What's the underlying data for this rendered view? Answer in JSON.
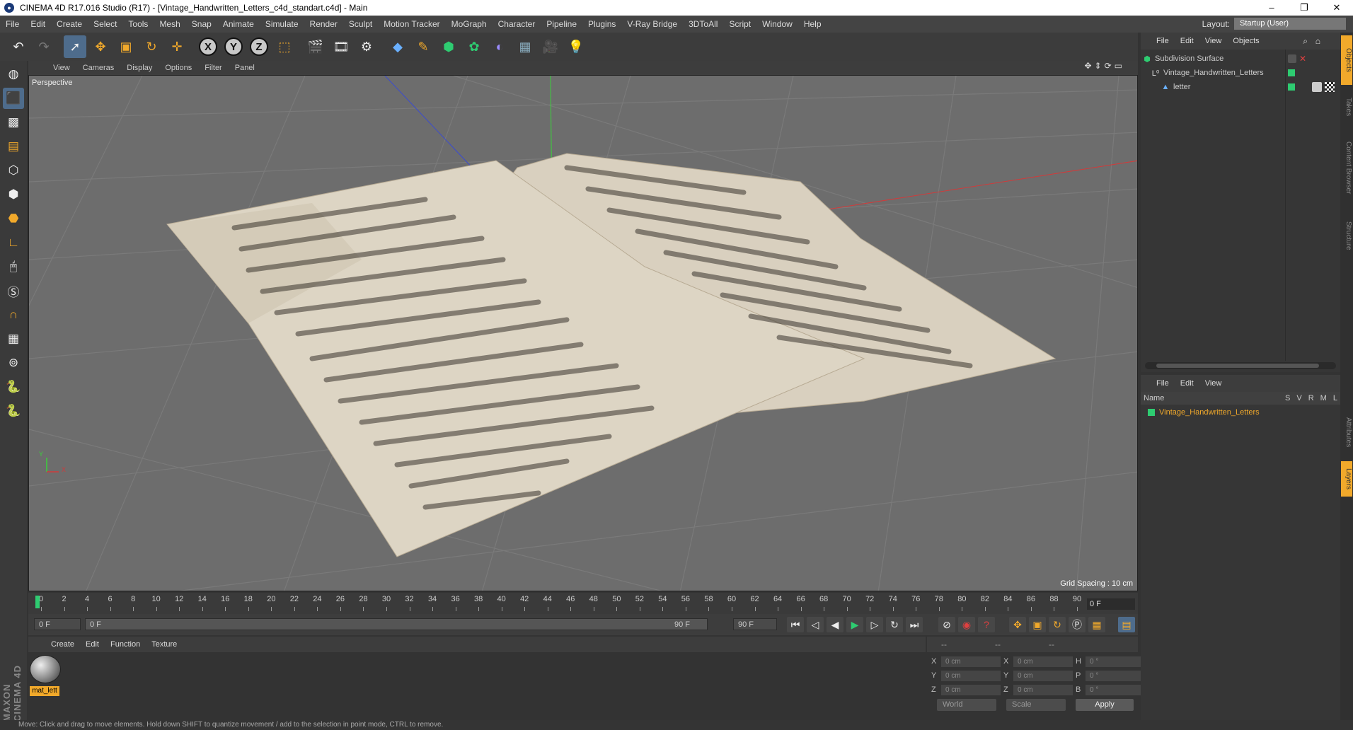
{
  "titlebar": {
    "title": "CINEMA 4D R17.016 Studio (R17) - [Vintage_Handwritten_Letters_c4d_standart.c4d] - Main",
    "min": "–",
    "restore": "❐",
    "close": "✕"
  },
  "menubar": {
    "items": [
      "File",
      "Edit",
      "Create",
      "Select",
      "Tools",
      "Mesh",
      "Snap",
      "Animate",
      "Simulate",
      "Render",
      "Sculpt",
      "Motion Tracker",
      "MoGraph",
      "Character",
      "Pipeline",
      "Plugins",
      "V-Ray Bridge",
      "3DToAll",
      "Script",
      "Window",
      "Help"
    ],
    "layout_label": "Layout:",
    "layout_value": "Startup (User)"
  },
  "toolbar": {
    "axis_x": "X",
    "axis_y": "Y",
    "axis_z": "Z"
  },
  "viewport": {
    "menu": [
      "View",
      "Cameras",
      "Display",
      "Options",
      "Filter",
      "Panel"
    ],
    "label": "Perspective",
    "grid_spacing": "Grid Spacing : 10 cm",
    "axis_x": "X",
    "axis_y": "Y"
  },
  "timeline": {
    "ticks": [
      "0",
      "2",
      "4",
      "6",
      "8",
      "10",
      "12",
      "14",
      "16",
      "18",
      "20",
      "22",
      "24",
      "26",
      "28",
      "30",
      "32",
      "34",
      "36",
      "38",
      "40",
      "42",
      "44",
      "46",
      "48",
      "50",
      "52",
      "54",
      "56",
      "58",
      "60",
      "62",
      "64",
      "66",
      "68",
      "70",
      "72",
      "74",
      "76",
      "78",
      "80",
      "82",
      "84",
      "86",
      "88",
      "90"
    ],
    "current": "0 F"
  },
  "transport": {
    "start": "0 F",
    "range_start": "0 F",
    "range_end": "90 F",
    "end": "90 F"
  },
  "material_manager": {
    "menu": [
      "Create",
      "Edit",
      "Function",
      "Texture"
    ],
    "material_name": "mat_lett"
  },
  "attributes": {
    "headers": [
      "--",
      "--",
      "--"
    ],
    "rows": [
      {
        "a1": "X",
        "v1": "0 cm",
        "a2": "X",
        "v2": "0 cm",
        "a3": "H",
        "v3": "0 °"
      },
      {
        "a1": "Y",
        "v1": "0 cm",
        "a2": "Y",
        "v2": "0 cm",
        "a3": "P",
        "v3": "0 °"
      },
      {
        "a1": "Z",
        "v1": "0 cm",
        "a2": "Z",
        "v2": "0 cm",
        "a3": "B",
        "v3": "0 °"
      }
    ],
    "coord_mode": "World",
    "size_mode": "Scale",
    "apply": "Apply"
  },
  "status": {
    "text": "Move: Click and drag to move elements. Hold down SHIFT to quantize movement / add to the selection in point mode, CTRL to remove."
  },
  "object_manager": {
    "menu": [
      "File",
      "Edit",
      "View",
      "Objects"
    ],
    "objects": [
      {
        "name": "Subdivision Surface",
        "icon": "subdivision-icon"
      },
      {
        "name": "Vintage_Handwritten_Letters",
        "icon": "null-object-icon"
      },
      {
        "name": "letter",
        "icon": "polygon-object-icon"
      }
    ]
  },
  "layer_manager": {
    "menu": [
      "File",
      "Edit",
      "View"
    ],
    "col_name": "Name",
    "cols": [
      "S",
      "V",
      "R",
      "M",
      "L"
    ],
    "layer_name": "Vintage_Handwritten_Letters",
    "layer_color": "#2ecc71"
  },
  "siderail": {
    "tabs": [
      "Objects",
      "Takes",
      "Content Browser",
      "Structure",
      "Attributes",
      "Layers"
    ]
  },
  "colors": {
    "accent": "#f1a92b",
    "selected_tool": "#4e6c8c",
    "viewport_bg": "#6d6d6d",
    "green_tag": "#2ecc71"
  }
}
